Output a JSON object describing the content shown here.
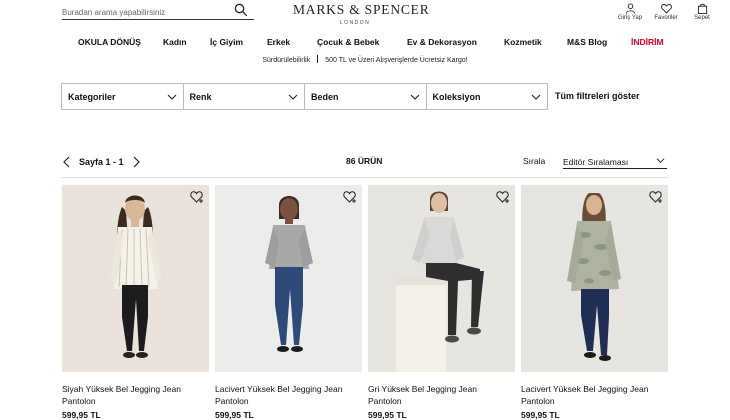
{
  "header": {
    "search_placeholder": "Buradan arama yapabilirsiniz",
    "logo": "MARKS & SPENCER",
    "logo_sub": "LONDON",
    "actions": [
      {
        "label": "Giriş Yap",
        "icon": "user-icon"
      },
      {
        "label": "Favoriler",
        "icon": "heart-icon"
      },
      {
        "label": "Sepet",
        "icon": "bag-icon"
      }
    ]
  },
  "nav": {
    "items": [
      "OKULA DÖNÜŞ",
      "Kadın",
      "İç Giyim",
      "Erkek",
      "Çocuk & Bebek",
      "Ev & Dekorasyon",
      "Kozmetik",
      "M&S Blog",
      "İNDİRİM"
    ],
    "sale_color": "#e4002b"
  },
  "promo": {
    "left": "Sürdürülebilirlik",
    "right": "500 TL ve Üzeri Alışverişlerde Ücretsiz Kargo!"
  },
  "filters": {
    "items": [
      "Kategoriler",
      "Renk",
      "Beden",
      "Koleksiyon"
    ],
    "all_label": "Tüm filtreleri göster"
  },
  "toolbar": {
    "page_label": "Sayfa 1 - 1",
    "count": "86 ÜRÜN",
    "sort_label": "Sırala",
    "sort_value": "Editör Sıralaması"
  },
  "products": [
    {
      "name": "Siyah Yüksek Bel Jegging Jean Pantolon",
      "price": "599,95 TL"
    },
    {
      "name": "Lacivert Yüksek Bel Jegging Jean Pantolon",
      "price": "599,95 TL"
    },
    {
      "name": "Gri Yüksek Bel Jegging Jean Pantolon",
      "price": "599,95 TL"
    },
    {
      "name": "Lacivert Yüksek Bel Jegging Jean Pantolon",
      "price": "599,95 TL"
    }
  ]
}
